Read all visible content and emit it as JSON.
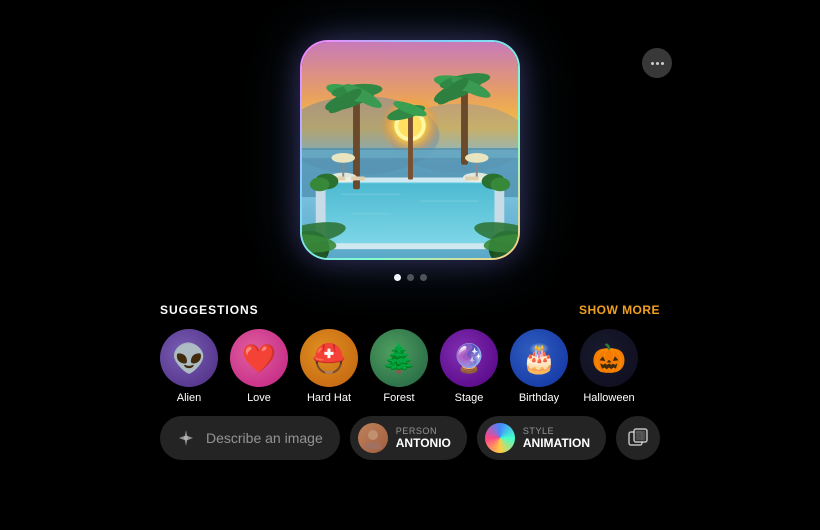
{
  "header": {
    "more_button_label": "···"
  },
  "pagination": {
    "dots": [
      true,
      false,
      false
    ],
    "active_index": 0
  },
  "suggestions": {
    "label": "SUGGESTIONS",
    "show_more_label": "SHOW MORE",
    "items": [
      {
        "name": "Alien",
        "emoji": "👽",
        "bg_class": "alien-bg"
      },
      {
        "name": "Love",
        "emoji": "❤️",
        "bg_class": "love-bg"
      },
      {
        "name": "Hard Hat",
        "emoji": "⛑️",
        "bg_class": "hardhat-bg"
      },
      {
        "name": "Forest",
        "emoji": "🌲",
        "bg_class": "forest-bg"
      },
      {
        "name": "Stage",
        "emoji": "🔮",
        "bg_class": "stage-bg"
      },
      {
        "name": "Birthday",
        "emoji": "🎂",
        "bg_class": "birthday-bg"
      },
      {
        "name": "Halloween",
        "emoji": "🎃",
        "bg_class": "halloween-bg"
      }
    ]
  },
  "bottom_bar": {
    "describe_placeholder": "Describe an image",
    "person_label_top": "PERSON",
    "person_label_bottom": "ANTONIO",
    "style_label_top": "STYLE",
    "style_label_bottom": "ANIMATION"
  }
}
